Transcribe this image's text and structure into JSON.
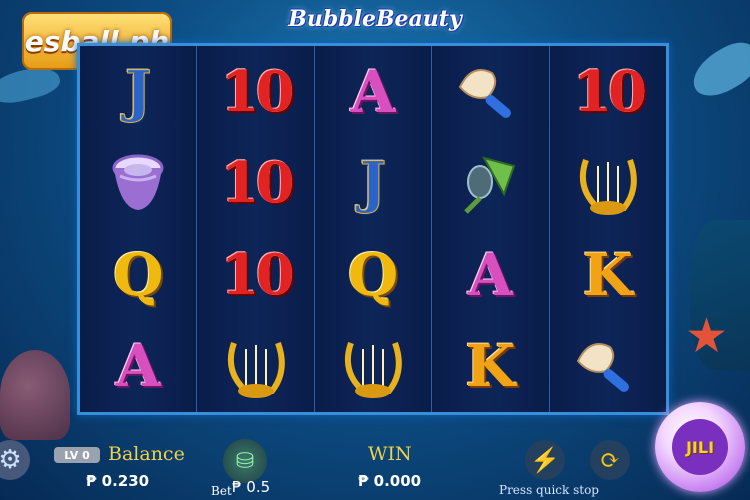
{
  "logo": {
    "text": "esball.ph"
  },
  "game_title": "BubbleBeauty",
  "reels": [
    [
      "J",
      "shell-drum",
      "Q",
      "A"
    ],
    [
      "10",
      "10",
      "10",
      "harp"
    ],
    [
      "A",
      "J",
      "Q",
      "harp"
    ],
    [
      "shell-wand",
      "shell-fan",
      "A",
      "K"
    ],
    [
      "10",
      "harp",
      "K",
      "shell-wand"
    ]
  ],
  "hud": {
    "level_badge": "LV 0",
    "balance_label": "Balance",
    "balance_value": "₱ 0.230",
    "bet_label": "Bet",
    "bet_value": "₱ 0.5",
    "win_label": "WIN",
    "win_value": "₱ 0.000",
    "quick_stop_label": "Press quick stop",
    "spin_label": "JILI"
  },
  "icons": {
    "settings": "gear-icon",
    "bet": "coin-stack-icon",
    "quick_stop": "lightning-icon",
    "auto_spin": "refresh-icon",
    "spin": "spin-icon"
  },
  "colors": {
    "board_border": "#3a8ed8",
    "label_gold": "#f0d14a",
    "ten_red": "#e22323",
    "ace_pink": "#d84fc0",
    "queen_gold": "#f0b90f",
    "king_orange": "#f0a315",
    "jack_blue": "#2a63c9"
  }
}
